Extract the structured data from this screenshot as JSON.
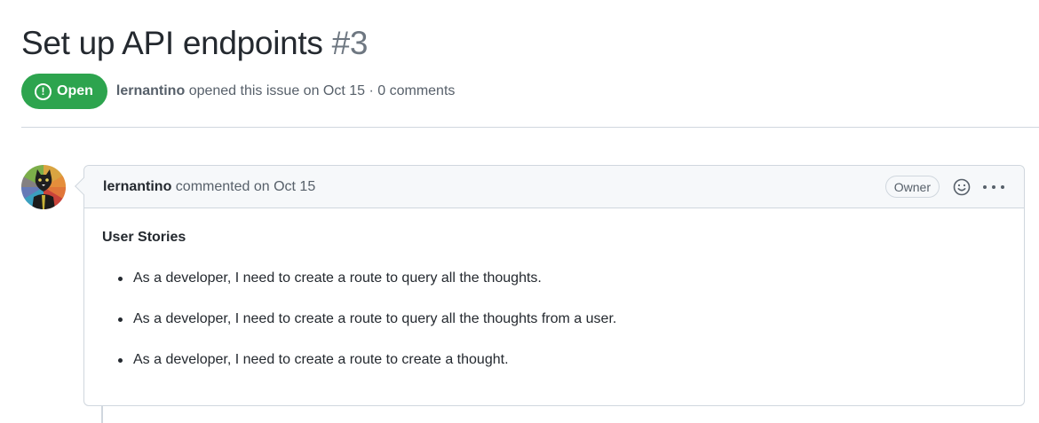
{
  "issue": {
    "title": "Set up API endpoints",
    "number": "#3",
    "state_label": "Open",
    "state_icon": "issue-opened-icon",
    "author": "lernantino",
    "meta_text": "opened this issue on Oct 15 · 0 comments",
    "state_color": "#2da44e"
  },
  "comment": {
    "author": "lernantino",
    "action_text": "commented on Oct 15",
    "role_badge": "Owner",
    "body_heading": "User Stories",
    "stories": [
      "As a developer, I need to create a route to query all the thoughts.",
      "As a developer, I need to create a route to query all the thoughts from a user.",
      "As a developer, I need to create a route to create a thought."
    ]
  }
}
